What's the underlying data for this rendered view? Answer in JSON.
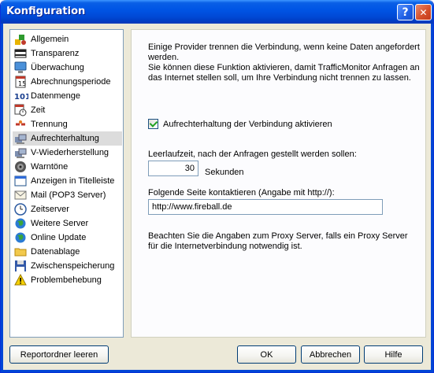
{
  "window": {
    "title": "Konfiguration",
    "help_glyph": "?",
    "close_glyph": "✕"
  },
  "sidebar": {
    "items": [
      {
        "label": "Allgemein",
        "icon": "general-icon"
      },
      {
        "label": "Transparenz",
        "icon": "transparency-icon"
      },
      {
        "label": "Überwachung",
        "icon": "monitor-icon"
      },
      {
        "label": "Abrechnungsperiode",
        "icon": "calendar-icon"
      },
      {
        "label": "Datenmenge",
        "icon": "data-amount-icon"
      },
      {
        "label": "Zeit",
        "icon": "clock-calendar-icon"
      },
      {
        "label": "Trennung",
        "icon": "disconnect-icon"
      },
      {
        "label": "Aufrechterhaltung",
        "icon": "keep-alive-icon",
        "selected": true
      },
      {
        "label": "V-Wiederherstellung",
        "icon": "reconnect-icon"
      },
      {
        "label": "Warntöne",
        "icon": "speaker-icon"
      },
      {
        "label": "Anzeigen in Titelleiste",
        "icon": "titlebar-icon"
      },
      {
        "label": "Mail (POP3 Server)",
        "icon": "mail-icon"
      },
      {
        "label": "Zeitserver",
        "icon": "timeserver-icon"
      },
      {
        "label": "Weitere Server",
        "icon": "globe-icon"
      },
      {
        "label": "Online Update",
        "icon": "globe-update-icon"
      },
      {
        "label": "Datenablage",
        "icon": "folder-icon"
      },
      {
        "label": "Zwischenspeicherung",
        "icon": "floppy-icon"
      },
      {
        "label": "Problembehebung",
        "icon": "warning-icon"
      }
    ]
  },
  "panel": {
    "intro_line1": "Einige Provider trennen die Verbindung, wenn keine Daten angefordert",
    "intro_line2": "werden.",
    "intro_line3": "Sie können diese Funktion aktivieren, damit TrafficMonitor Anfragen an",
    "intro_line4": "das Internet stellen soll, um Ihre Verbindung nicht trennen zu lassen.",
    "checkbox_label": "Aufrechterhaltung der Verbindung aktivieren",
    "checkbox_checked": true,
    "idle_label": "Leerlaufzeit, nach der Anfragen gestellt werden sollen:",
    "idle_value": "30",
    "idle_unit": "Sekunden",
    "url_label": "Folgende Seite kontaktieren (Angabe mit http://):",
    "url_value": "http://www.fireball.de",
    "proxy_line1": "Beachten Sie die Angaben zum Proxy Server, falls ein Proxy Server",
    "proxy_line2": "für die Internetverbindung notwendig ist."
  },
  "buttons": {
    "clear_report": "Reportordner leeren",
    "ok": "OK",
    "cancel": "Abbrechen",
    "help": "Hilfe"
  }
}
